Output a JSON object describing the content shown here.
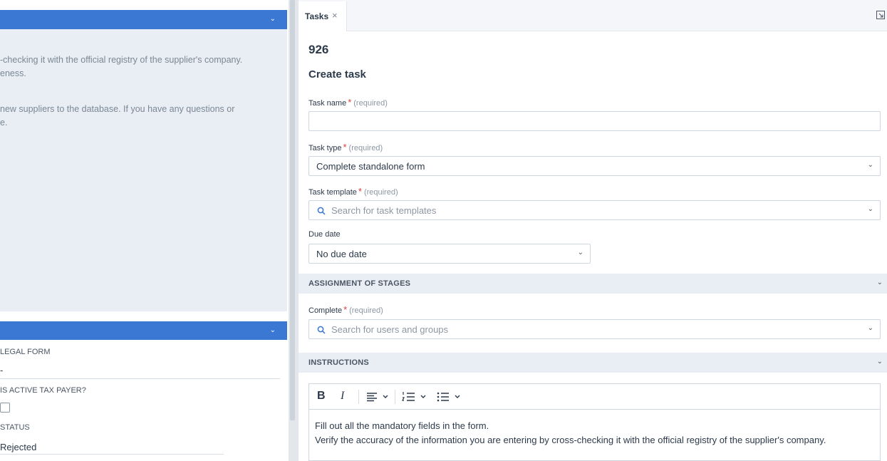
{
  "left_panel": {
    "description_lines": [
      "-checking it with the official registry of the supplier's company.",
      "eness.",
      "new suppliers to the database. If you have any questions or",
      "e."
    ],
    "fields": [
      {
        "label": "LEGAL FORM",
        "value": "-"
      },
      {
        "label": "IS ACTIVE TAX PAYER?",
        "value": ""
      },
      {
        "label": "STATUS",
        "value": "Rejected"
      }
    ]
  },
  "tabs": [
    {
      "label": "Tasks",
      "close": "×"
    }
  ],
  "task": {
    "id": "926",
    "heading": "Create task",
    "required_text": "(required)",
    "required_star": "*",
    "task_name": {
      "label": "Task name",
      "value": ""
    },
    "task_type": {
      "label": "Task type",
      "value": "Complete standalone form"
    },
    "task_template": {
      "label": "Task template",
      "placeholder": "Search for task templates"
    },
    "due_date": {
      "label": "Due date",
      "value": "No due date"
    }
  },
  "sections": {
    "assignment": {
      "title": "ASSIGNMENT OF STAGES",
      "complete_label": "Complete",
      "complete_placeholder": "Search for users and groups"
    },
    "instructions": {
      "title": "INSTRUCTIONS",
      "toolbar": {
        "bold": "B",
        "italic": "I"
      },
      "lines": [
        "Fill out all the mandatory fields in the form.",
        "Verify the accuracy of the information you are entering by cross-checking it with the official registry of the supplier's company."
      ]
    }
  },
  "icons": {
    "chevron": "⌄",
    "search": "search-icon",
    "expand": "expand-icon"
  },
  "colors": {
    "accent_blue": "#3a78d4",
    "required_red": "#d93b3b",
    "section_bg": "#e9eef4"
  }
}
